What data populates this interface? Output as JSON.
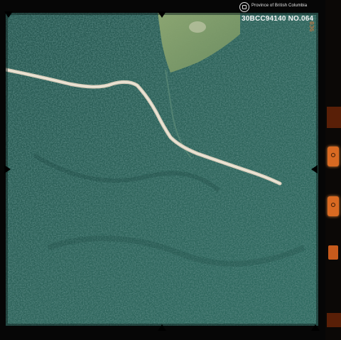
{
  "header": {
    "org": "Province of British Columbia",
    "frame_id": "30BCC94140 NO.064",
    "frame_sequence": "036"
  },
  "colors": {
    "forest_dark": "#1e4a44",
    "forest_mid": "#2f6a5e",
    "clearing": "#7f9c6a",
    "road": "#e6dccb",
    "gauge_orange": "#d96a22"
  }
}
